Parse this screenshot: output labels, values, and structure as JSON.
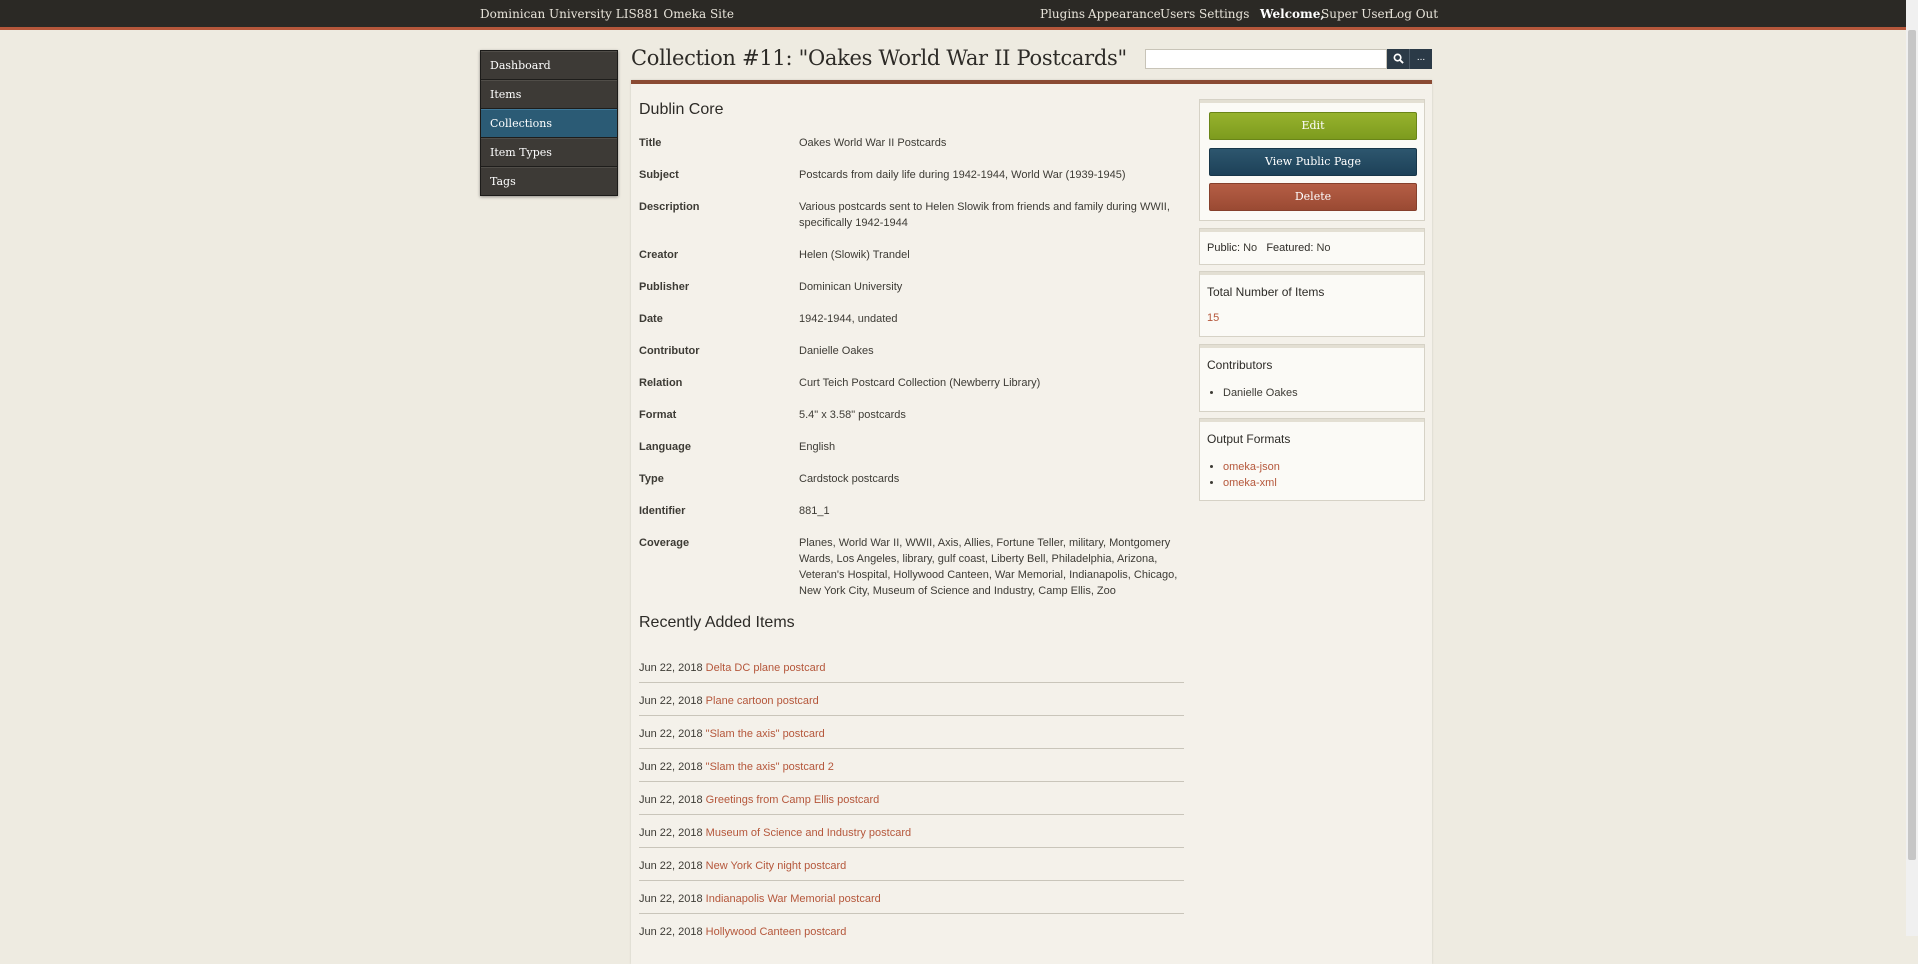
{
  "topbar": {
    "site_name": "Dominican University LIS881 Omeka Site",
    "nav": [
      "Plugins",
      "Appearance",
      "Users",
      "Settings"
    ],
    "welcome_label": "Welcome,",
    "user_name": "Super User",
    "logout_label": "Log Out"
  },
  "sidebar": {
    "items": [
      {
        "label": "Dashboard"
      },
      {
        "label": "Items"
      },
      {
        "label": "Collections",
        "active": true
      },
      {
        "label": "Item Types"
      },
      {
        "label": "Tags"
      }
    ]
  },
  "page": {
    "title": "Collection #11: \"Oakes World War II Postcards\""
  },
  "search": {
    "placeholder": "",
    "search_icon": "search-icon",
    "more_label": "..."
  },
  "dublin_core": {
    "heading": "Dublin Core",
    "fields": [
      {
        "name": "Title",
        "value": "Oakes World War II Postcards"
      },
      {
        "name": "Subject",
        "value": "Postcards from daily life during 1942-1944, World War (1939-1945)"
      },
      {
        "name": "Description",
        "value": "Various postcards sent to Helen Slowik from friends and family during WWII, specifically 1942-1944"
      },
      {
        "name": "Creator",
        "value": "Helen (Slowik) Trandel"
      },
      {
        "name": "Publisher",
        "value": "Dominican University"
      },
      {
        "name": "Date",
        "value": "1942-1944, undated"
      },
      {
        "name": "Contributor",
        "value": "Danielle Oakes"
      },
      {
        "name": "Relation",
        "value": "Curt Teich Postcard Collection (Newberry Library)"
      },
      {
        "name": "Format",
        "value": "5.4\" x 3.58\" postcards"
      },
      {
        "name": "Language",
        "value": "English"
      },
      {
        "name": "Type",
        "value": "Cardstock postcards"
      },
      {
        "name": "Identifier",
        "value": "881_1"
      },
      {
        "name": "Coverage",
        "value": "Planes, World War II, WWII, Axis, Allies, Fortune Teller, military, Montgomery Wards, Los Angeles, library, gulf coast, Liberty Bell, Philadelphia, Arizona, Veteran's Hospital, Hollywood Canteen, War Memorial, Indianapolis, Chicago, New York City, Museum of Science and Industry, Camp Ellis, Zoo"
      }
    ]
  },
  "recent": {
    "heading": "Recently Added Items",
    "items": [
      {
        "date": "Jun 22, 2018",
        "title": "Delta DC plane postcard"
      },
      {
        "date": "Jun 22, 2018",
        "title": "Plane cartoon postcard"
      },
      {
        "date": "Jun 22, 2018",
        "title": "\"Slam the axis\" postcard"
      },
      {
        "date": "Jun 22, 2018",
        "title": "\"Slam the axis\" postcard 2"
      },
      {
        "date": "Jun 22, 2018",
        "title": "Greetings from Camp Ellis postcard"
      },
      {
        "date": "Jun 22, 2018",
        "title": "Museum of Science and Industry postcard"
      },
      {
        "date": "Jun 22, 2018",
        "title": "New York City night postcard"
      },
      {
        "date": "Jun 22, 2018",
        "title": "Indianapolis War Memorial postcard"
      },
      {
        "date": "Jun 22, 2018",
        "title": "Hollywood Canteen postcard"
      }
    ]
  },
  "actions": {
    "edit": "Edit",
    "view_public": "View Public Page",
    "delete": "Delete"
  },
  "status": {
    "public_label": "Public:",
    "public_value": "No",
    "featured_label": "Featured:",
    "featured_value": "No"
  },
  "total_items": {
    "heading": "Total Number of Items",
    "count": "15"
  },
  "contributors": {
    "heading": "Contributors",
    "items": [
      "Danielle Oakes"
    ]
  },
  "output_formats": {
    "heading": "Output Formats",
    "items": [
      "omeka-json",
      "omeka-xml"
    ]
  },
  "colors": {
    "accent": "#b5573b",
    "active_nav": "#2b5b75",
    "edit_button": "#8aa626",
    "public_button": "#244b62",
    "delete_button": "#a8543c"
  }
}
